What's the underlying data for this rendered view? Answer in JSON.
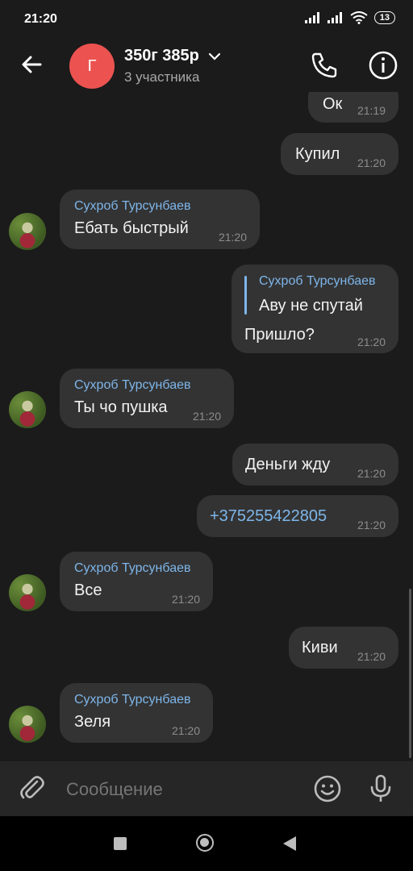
{
  "status_bar": {
    "time": "21:20",
    "battery": "13"
  },
  "header": {
    "title": "350г 385р",
    "subtitle": "3 участника",
    "avatar_letter": "Г"
  },
  "messages": [
    {
      "dir": "out",
      "text": "Ок",
      "time": "21:19"
    },
    {
      "dir": "out",
      "text": "Купил",
      "time": "21:20"
    },
    {
      "dir": "in",
      "sender": "Сухроб Турсунбаев",
      "text": "Ебать быстрый",
      "time": "21:20"
    },
    {
      "dir": "out",
      "quote_sender": "Сухроб Турсунбаев",
      "quote_text": "Аву не спутай",
      "text": "Пришло?",
      "time": "21:20"
    },
    {
      "dir": "in",
      "sender": "Сухроб Турсунбаев",
      "text": "Ты чо пушка",
      "time": "21:20"
    },
    {
      "dir": "out",
      "text": "Деньги жду",
      "time": "21:20"
    },
    {
      "dir": "out",
      "text": "+375255422805",
      "time": "21:20"
    },
    {
      "dir": "in",
      "sender": "Сухроб Турсунбаев",
      "text": "Все",
      "time": "21:20"
    },
    {
      "dir": "out",
      "text": "Киви",
      "time": "21:20"
    },
    {
      "dir": "in",
      "sender": "Сухроб Турсунбаев",
      "text": "Зеля",
      "time": "21:20"
    }
  ],
  "input": {
    "placeholder": "Сообщение"
  },
  "colors": {
    "background": "#1b1b1b",
    "bubble": "#333333",
    "accent": "#7eb6ea",
    "avatar": "#ec5350"
  },
  "icons": [
    "back-arrow-icon",
    "chevron-down-icon",
    "phone-icon",
    "info-icon",
    "paperclip-icon",
    "emoji-icon",
    "microphone-icon"
  ]
}
